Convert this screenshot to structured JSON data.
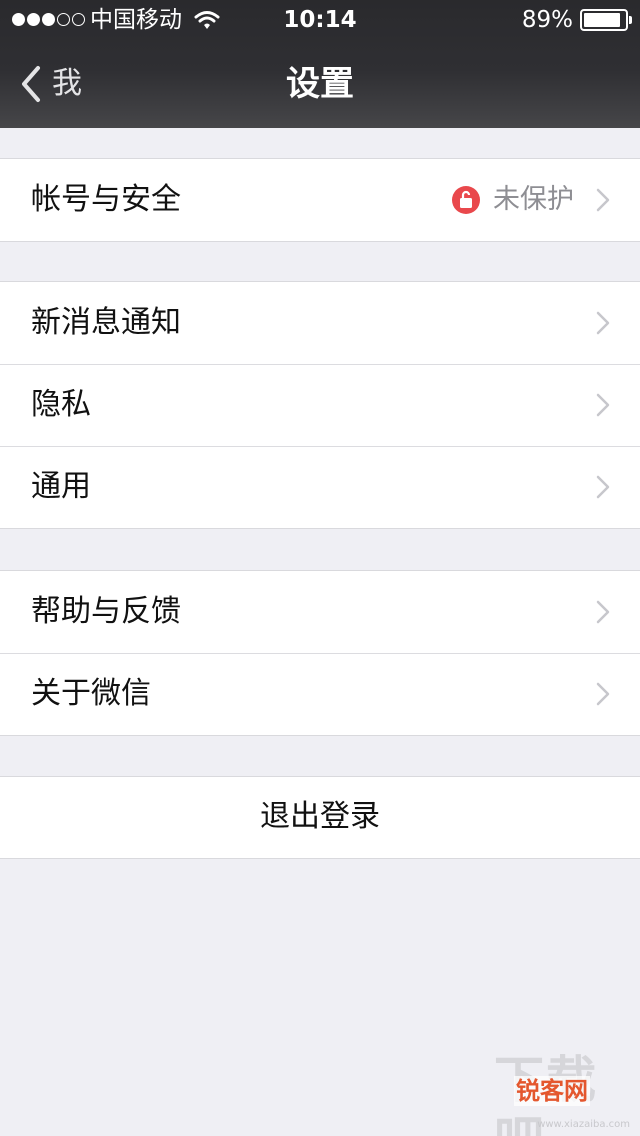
{
  "status_bar": {
    "signal_bars": 3,
    "signal_total": 5,
    "carrier": "中国移动",
    "time": "10:14",
    "battery_percent": "89%",
    "battery_level": 0.89
  },
  "nav": {
    "back_label": "我",
    "title": "设置"
  },
  "groups": [
    {
      "items": [
        {
          "label": "帐号与安全",
          "value": "未保护",
          "icon": "lock-icon",
          "has_arrow": true
        }
      ]
    },
    {
      "items": [
        {
          "label": "新消息通知",
          "has_arrow": true
        },
        {
          "label": "隐私",
          "has_arrow": true
        },
        {
          "label": "通用",
          "has_arrow": true
        }
      ]
    },
    {
      "items": [
        {
          "label": "帮助与反馈",
          "has_arrow": true
        },
        {
          "label": "关于微信",
          "has_arrow": true
        }
      ]
    }
  ],
  "logout_label": "退出登录",
  "watermark": {
    "big": "下载吧",
    "small": "锐客网",
    "url": "www.xiazaiba.com"
  },
  "colors": {
    "background": "#efeff4",
    "navbar": "#2f2f33",
    "unprotected_badge": "#e9484c",
    "secondary_text": "#8e8e93"
  }
}
